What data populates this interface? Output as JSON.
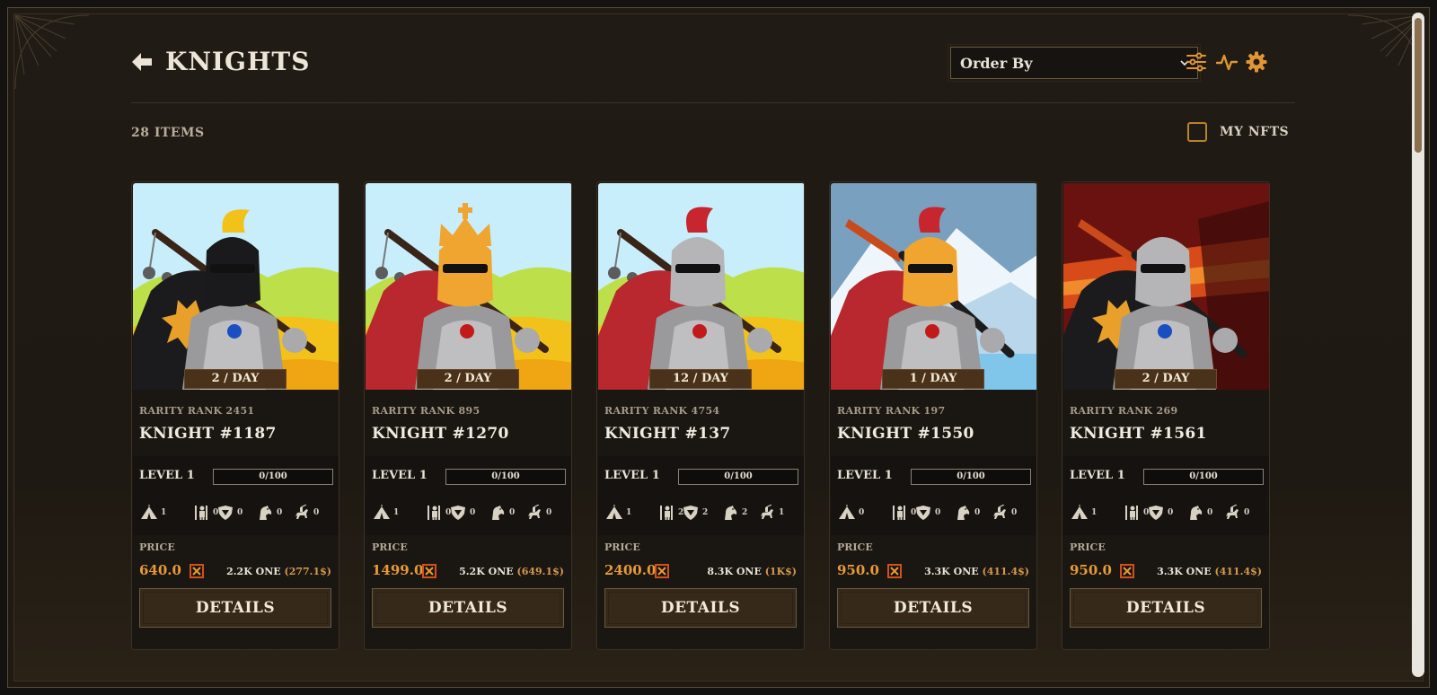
{
  "header": {
    "title": "KNIGHTS",
    "order_by": "Order By"
  },
  "toolbar": {
    "items_count": "28 ITEMS",
    "my_nfts_label": "MY NFTS",
    "my_nfts_checked": false
  },
  "labels": {
    "level": "LEVEL 1",
    "price": "PRICE",
    "details": "DETAILS"
  },
  "colors": {
    "accent": "#e89a36",
    "button_bg": "#36291a",
    "panel_bg": "#1f1a14"
  },
  "cards": [
    {
      "yield": "2 / DAY",
      "rarity": "RARITY RANK 2451",
      "name": "KNIGHT #1187",
      "xp": "0/100",
      "xp_fraction": 0,
      "units": [
        "1",
        "0",
        "0",
        "0",
        "0"
      ],
      "price": "640.0",
      "price_one": "2.2K ONE",
      "price_usd": "(277.1$)",
      "background": "meadow",
      "helmet": "black",
      "plume": "yellow",
      "cape": "black-cross",
      "weapon": "flail"
    },
    {
      "yield": "2 / DAY",
      "rarity": "RARITY RANK 895",
      "name": "KNIGHT #1270",
      "xp": "0/100",
      "xp_fraction": 0,
      "units": [
        "1",
        "0",
        "0",
        "0",
        "0"
      ],
      "price": "1499.0",
      "price_one": "5.2K ONE",
      "price_usd": "(649.1$)",
      "background": "meadow",
      "helmet": "gold-crown",
      "plume": "none",
      "cape": "red",
      "weapon": "flail"
    },
    {
      "yield": "12 / DAY",
      "rarity": "RARITY RANK 4754",
      "name": "KNIGHT #137",
      "xp": "0/100",
      "xp_fraction": 0,
      "units": [
        "1",
        "2",
        "2",
        "2",
        "1"
      ],
      "price": "2400.0",
      "price_one": "8.3K ONE",
      "price_usd": "(1K$)",
      "background": "meadow",
      "helmet": "silver",
      "plume": "red",
      "cape": "red",
      "weapon": "flail"
    },
    {
      "yield": "1 / DAY",
      "rarity": "RARITY RANK 197",
      "name": "KNIGHT #1550",
      "xp": "0/100",
      "xp_fraction": 0,
      "units": [
        "0",
        "0",
        "0",
        "0",
        "0"
      ],
      "price": "950.0",
      "price_one": "3.3K ONE",
      "price_usd": "(411.4$)",
      "background": "mountains",
      "helmet": "gold",
      "plume": "red",
      "cape": "red",
      "weapon": "flame-sword"
    },
    {
      "yield": "2 / DAY",
      "rarity": "RARITY RANK 269",
      "name": "KNIGHT #1561",
      "xp": "0/100",
      "xp_fraction": 0,
      "units": [
        "1",
        "0",
        "0",
        "0",
        "0"
      ],
      "price": "950.0",
      "price_one": "3.3K ONE",
      "price_usd": "(411.4$)",
      "background": "lava",
      "helmet": "silver",
      "plume": "none",
      "cape": "black-cross",
      "weapon": "flame-sword"
    }
  ],
  "unit_icons": [
    "tent-icon",
    "spearman-icon",
    "shield-icon",
    "horse-icon",
    "cavalry-icon"
  ]
}
